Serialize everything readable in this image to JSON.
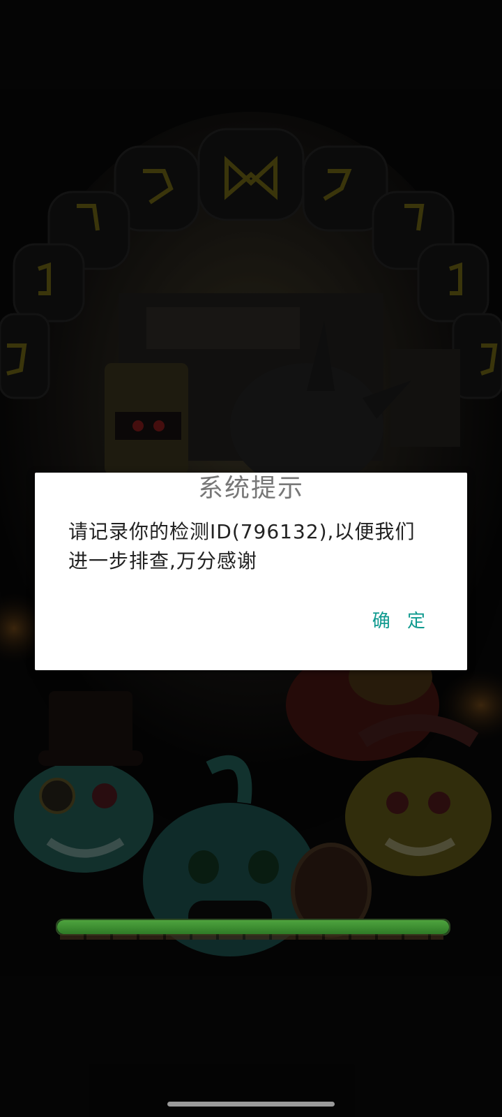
{
  "dialog": {
    "title": "系统提示",
    "message": "请记录你的检测ID(796132),以便我们进一步排查,万分感谢",
    "confirm_label": "确 定"
  },
  "loading": {
    "progress": 1.0
  },
  "colors": {
    "dialog_bg": "#ffffff",
    "title_text": "#777777",
    "message_text": "#222222",
    "confirm_text": "#0f9a8f",
    "progress_fill": "#4ea33e"
  }
}
